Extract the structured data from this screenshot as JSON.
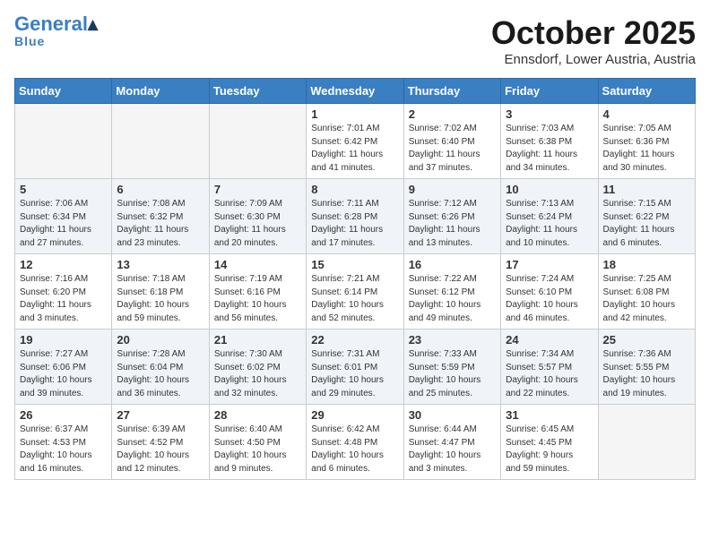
{
  "header": {
    "logo_general": "General",
    "logo_blue": "Blue",
    "month_title": "October 2025",
    "location": "Ennsdorf, Lower Austria, Austria"
  },
  "weekdays": [
    "Sunday",
    "Monday",
    "Tuesday",
    "Wednesday",
    "Thursday",
    "Friday",
    "Saturday"
  ],
  "weeks": [
    [
      {
        "day": "",
        "info": ""
      },
      {
        "day": "",
        "info": ""
      },
      {
        "day": "",
        "info": ""
      },
      {
        "day": "1",
        "info": "Sunrise: 7:01 AM\nSunset: 6:42 PM\nDaylight: 11 hours\nand 41 minutes."
      },
      {
        "day": "2",
        "info": "Sunrise: 7:02 AM\nSunset: 6:40 PM\nDaylight: 11 hours\nand 37 minutes."
      },
      {
        "day": "3",
        "info": "Sunrise: 7:03 AM\nSunset: 6:38 PM\nDaylight: 11 hours\nand 34 minutes."
      },
      {
        "day": "4",
        "info": "Sunrise: 7:05 AM\nSunset: 6:36 PM\nDaylight: 11 hours\nand 30 minutes."
      }
    ],
    [
      {
        "day": "5",
        "info": "Sunrise: 7:06 AM\nSunset: 6:34 PM\nDaylight: 11 hours\nand 27 minutes."
      },
      {
        "day": "6",
        "info": "Sunrise: 7:08 AM\nSunset: 6:32 PM\nDaylight: 11 hours\nand 23 minutes."
      },
      {
        "day": "7",
        "info": "Sunrise: 7:09 AM\nSunset: 6:30 PM\nDaylight: 11 hours\nand 20 minutes."
      },
      {
        "day": "8",
        "info": "Sunrise: 7:11 AM\nSunset: 6:28 PM\nDaylight: 11 hours\nand 17 minutes."
      },
      {
        "day": "9",
        "info": "Sunrise: 7:12 AM\nSunset: 6:26 PM\nDaylight: 11 hours\nand 13 minutes."
      },
      {
        "day": "10",
        "info": "Sunrise: 7:13 AM\nSunset: 6:24 PM\nDaylight: 11 hours\nand 10 minutes."
      },
      {
        "day": "11",
        "info": "Sunrise: 7:15 AM\nSunset: 6:22 PM\nDaylight: 11 hours\nand 6 minutes."
      }
    ],
    [
      {
        "day": "12",
        "info": "Sunrise: 7:16 AM\nSunset: 6:20 PM\nDaylight: 11 hours\nand 3 minutes."
      },
      {
        "day": "13",
        "info": "Sunrise: 7:18 AM\nSunset: 6:18 PM\nDaylight: 10 hours\nand 59 minutes."
      },
      {
        "day": "14",
        "info": "Sunrise: 7:19 AM\nSunset: 6:16 PM\nDaylight: 10 hours\nand 56 minutes."
      },
      {
        "day": "15",
        "info": "Sunrise: 7:21 AM\nSunset: 6:14 PM\nDaylight: 10 hours\nand 52 minutes."
      },
      {
        "day": "16",
        "info": "Sunrise: 7:22 AM\nSunset: 6:12 PM\nDaylight: 10 hours\nand 49 minutes."
      },
      {
        "day": "17",
        "info": "Sunrise: 7:24 AM\nSunset: 6:10 PM\nDaylight: 10 hours\nand 46 minutes."
      },
      {
        "day": "18",
        "info": "Sunrise: 7:25 AM\nSunset: 6:08 PM\nDaylight: 10 hours\nand 42 minutes."
      }
    ],
    [
      {
        "day": "19",
        "info": "Sunrise: 7:27 AM\nSunset: 6:06 PM\nDaylight: 10 hours\nand 39 minutes."
      },
      {
        "day": "20",
        "info": "Sunrise: 7:28 AM\nSunset: 6:04 PM\nDaylight: 10 hours\nand 36 minutes."
      },
      {
        "day": "21",
        "info": "Sunrise: 7:30 AM\nSunset: 6:02 PM\nDaylight: 10 hours\nand 32 minutes."
      },
      {
        "day": "22",
        "info": "Sunrise: 7:31 AM\nSunset: 6:01 PM\nDaylight: 10 hours\nand 29 minutes."
      },
      {
        "day": "23",
        "info": "Sunrise: 7:33 AM\nSunset: 5:59 PM\nDaylight: 10 hours\nand 25 minutes."
      },
      {
        "day": "24",
        "info": "Sunrise: 7:34 AM\nSunset: 5:57 PM\nDaylight: 10 hours\nand 22 minutes."
      },
      {
        "day": "25",
        "info": "Sunrise: 7:36 AM\nSunset: 5:55 PM\nDaylight: 10 hours\nand 19 minutes."
      }
    ],
    [
      {
        "day": "26",
        "info": "Sunrise: 6:37 AM\nSunset: 4:53 PM\nDaylight: 10 hours\nand 16 minutes."
      },
      {
        "day": "27",
        "info": "Sunrise: 6:39 AM\nSunset: 4:52 PM\nDaylight: 10 hours\nand 12 minutes."
      },
      {
        "day": "28",
        "info": "Sunrise: 6:40 AM\nSunset: 4:50 PM\nDaylight: 10 hours\nand 9 minutes."
      },
      {
        "day": "29",
        "info": "Sunrise: 6:42 AM\nSunset: 4:48 PM\nDaylight: 10 hours\nand 6 minutes."
      },
      {
        "day": "30",
        "info": "Sunrise: 6:44 AM\nSunset: 4:47 PM\nDaylight: 10 hours\nand 3 minutes."
      },
      {
        "day": "31",
        "info": "Sunrise: 6:45 AM\nSunset: 4:45 PM\nDaylight: 9 hours\nand 59 minutes."
      },
      {
        "day": "",
        "info": ""
      }
    ]
  ]
}
